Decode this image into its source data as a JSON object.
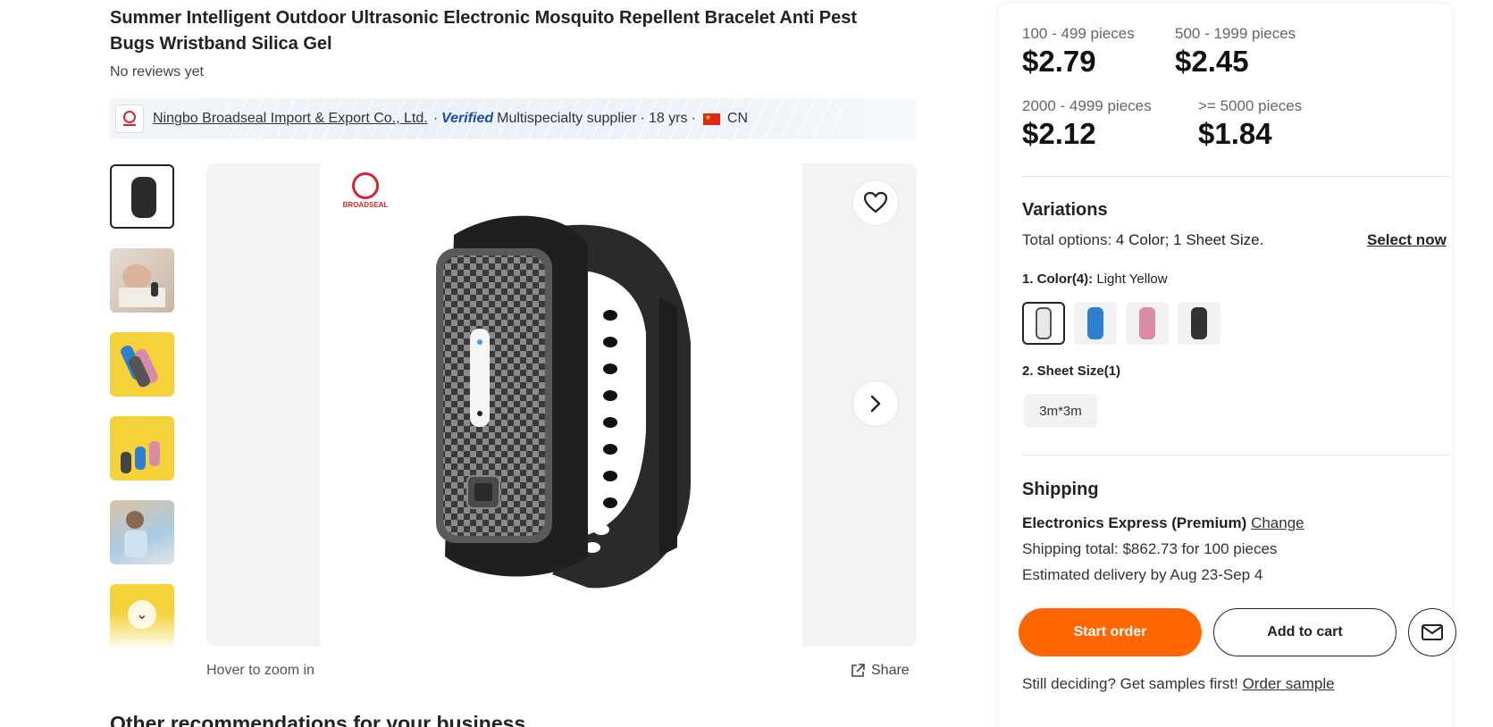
{
  "product": {
    "title": "Summer Intelligent Outdoor Ultrasonic Electronic Mosquito Repellent Bracelet Anti Pest Bugs Wristband Silica Gel",
    "reviews": "No reviews yet"
  },
  "supplier": {
    "name": "Ningbo Broadseal Import & Export Co., Ltd.",
    "separator": "·",
    "verified": "Verified",
    "type": "Multispecialty supplier",
    "years": "18 yrs",
    "country": "CN"
  },
  "gallery": {
    "brand_text": "BROADSEAL",
    "zoom_hint": "Hover to zoom in",
    "share_label": "Share"
  },
  "recommendations_title": "Other recommendations for your business",
  "pricing": {
    "tiers": [
      {
        "range": "100 - 499 pieces",
        "price": "$2.79"
      },
      {
        "range": "500 - 1999 pieces",
        "price": "$2.45"
      },
      {
        "range": "2000 - 4999 pieces",
        "price": "$2.12"
      },
      {
        "range": ">= 5000 pieces",
        "price": "$1.84"
      }
    ]
  },
  "variations": {
    "title": "Variations",
    "total_prefix": "Total options:",
    "total_value": "4 Color; 1 Sheet Size.",
    "select_now": "Select now",
    "color_label": "1. Color(4):",
    "color_selected": "Light Yellow",
    "swatch_colors": [
      "#e8e8e8",
      "#2f7fd0",
      "#d88aa6",
      "#333333"
    ],
    "size_label": "2. Sheet Size(1)",
    "size_value": "3m*3m"
  },
  "shipping": {
    "title": "Shipping",
    "method": "Electronics Express (Premium)",
    "change": "Change",
    "total": "Shipping total: $862.73 for 100 pieces",
    "delivery": "Estimated delivery by Aug 23-Sep 4"
  },
  "actions": {
    "start_order": "Start order",
    "add_to_cart": "Add to cart",
    "samples_prefix": "Still deciding? Get samples first!",
    "order_sample": "Order sample"
  },
  "colors": {
    "accent": "#ff6600",
    "verified_blue": "#1b4fa3",
    "brand_red": "#d6252f"
  }
}
